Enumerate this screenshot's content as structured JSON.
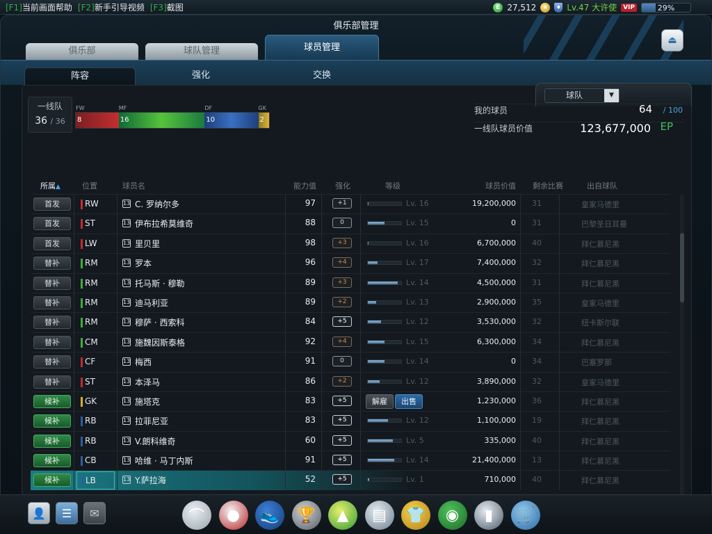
{
  "hotkeys": [
    {
      "key": "[F1]",
      "label": "当前画面帮助"
    },
    {
      "key": "[F2]",
      "label": "新手引导视频"
    },
    {
      "key": "[F3]",
      "label": "截图"
    }
  ],
  "status": {
    "coin_icon": "E",
    "money": "27,512",
    "level": "Lv.47 大许使",
    "vip": "VIP",
    "progress_label": "29%",
    "progress": 0.29
  },
  "window_title": "俱乐部管理",
  "main_tabs": [
    "俱乐部",
    "球队管理",
    "球员管理"
  ],
  "sub_tabs": [
    "阵容",
    "强化",
    "交换"
  ],
  "filter": {
    "value": "球队",
    "arrow": "▼"
  },
  "lineup": {
    "label": "一线队",
    "count": "36",
    "total": "/ 36"
  },
  "positions": [
    {
      "label": "FW",
      "count": "8",
      "color": "#c32c2c"
    },
    {
      "label": "MF",
      "count": "16",
      "color": "#3fae3a"
    },
    {
      "label": "DF",
      "count": "10",
      "color": "#2e5da5"
    },
    {
      "label": "GK",
      "count": "2",
      "color": "#d8b12c"
    }
  ],
  "summary": {
    "my_players_label": "我的球员",
    "my_players": "64",
    "my_players_max": "/ 100",
    "value_label": "一线队球员价值",
    "value": "123,677,000",
    "currency": "EP"
  },
  "columns": {
    "role": "所属",
    "sort_icon": "▲",
    "pos": "位置",
    "name": "球员名",
    "ability": "能力值",
    "enhance": "强化",
    "grade": "等级",
    "value": "球员价值",
    "remaining": "剩余比赛",
    "club": "出自球队"
  },
  "actions": {
    "fire": "解雇",
    "sell": "出售"
  },
  "players": [
    {
      "role": "首发",
      "role_type": "start",
      "pos": "RW",
      "pos_color": "#c32c2c",
      "age": "13",
      "name": "C. 罗纳尔多",
      "ability": "97",
      "enhance": "+1",
      "enh_style": "w",
      "level_fill": 0.02,
      "level": "Lv. 16",
      "value": "19,200,000",
      "remaining": "31",
      "club": "皇家马德里"
    },
    {
      "role": "首发",
      "role_type": "start",
      "pos": "ST",
      "pos_color": "#c32c2c",
      "age": "13",
      "name": "伊布拉希莫维奇",
      "ability": "88",
      "enhance": "0",
      "enh_style": "w",
      "level_fill": 0.5,
      "level": "Lv. 15",
      "value": "0",
      "remaining": "31",
      "club": "巴黎圣日耳曼"
    },
    {
      "role": "首发",
      "role_type": "start",
      "pos": "LW",
      "pos_color": "#c32c2c",
      "age": "13",
      "name": "里贝里",
      "ability": "98",
      "enhance": "+3",
      "enh_style": "o",
      "level_fill": 0.02,
      "level": "Lv. 16",
      "value": "6,700,000",
      "remaining": "40",
      "club": "拜仁慕尼黑"
    },
    {
      "role": "替补",
      "role_type": "sub",
      "pos": "RM",
      "pos_color": "#3fae3a",
      "age": "13",
      "name": "罗本",
      "ability": "96",
      "enhance": "+4",
      "enh_style": "o",
      "level_fill": 0.3,
      "level": "Lv. 17",
      "value": "7,400,000",
      "remaining": "32",
      "club": "拜仁慕尼黑"
    },
    {
      "role": "替补",
      "role_type": "sub",
      "pos": "RM",
      "pos_color": "#3fae3a",
      "age": "13",
      "name": "托马斯 · 穆勒",
      "ability": "89",
      "enhance": "+3",
      "enh_style": "o",
      "level_fill": 0.9,
      "level": "Lv. 14",
      "value": "4,500,000",
      "remaining": "31",
      "club": "拜仁慕尼黑"
    },
    {
      "role": "替补",
      "role_type": "sub",
      "pos": "RM",
      "pos_color": "#3fae3a",
      "age": "13",
      "name": "迪马利亚",
      "ability": "89",
      "enhance": "+2",
      "enh_style": "o",
      "level_fill": 0.25,
      "level": "Lv. 13",
      "value": "2,900,000",
      "remaining": "35",
      "club": "皇家马德里"
    },
    {
      "role": "替补",
      "role_type": "sub",
      "pos": "RM",
      "pos_color": "#3fae3a",
      "age": "13",
      "name": "穆萨 · 西索科",
      "ability": "84",
      "enhance": "+5",
      "enh_style": "b",
      "level_fill": 0.4,
      "level": "Lv. 12",
      "value": "3,530,000",
      "remaining": "32",
      "club": "纽卡斯尔联"
    },
    {
      "role": "替补",
      "role_type": "sub",
      "pos": "CM",
      "pos_color": "#3fae3a",
      "age": "13",
      "name": "施魏因斯泰格",
      "ability": "92",
      "enhance": "+4",
      "enh_style": "o",
      "level_fill": 0.5,
      "level": "Lv. 15",
      "value": "6,300,000",
      "remaining": "34",
      "club": "拜仁慕尼黑"
    },
    {
      "role": "替补",
      "role_type": "sub",
      "pos": "CF",
      "pos_color": "#c32c2c",
      "age": "13",
      "name": "梅西",
      "ability": "91",
      "enhance": "0",
      "enh_style": "w",
      "level_fill": 0.5,
      "level": "Lv. 14",
      "value": "0",
      "remaining": "34",
      "club": "巴塞罗那"
    },
    {
      "role": "替补",
      "role_type": "sub",
      "pos": "ST",
      "pos_color": "#c32c2c",
      "age": "13",
      "name": "本泽马",
      "ability": "86",
      "enhance": "+2",
      "enh_style": "o",
      "level_fill": 0.35,
      "level": "Lv. 12",
      "value": "3,890,000",
      "remaining": "32",
      "club": "皇家马德里"
    },
    {
      "role": "候补",
      "role_type": "res",
      "pos": "GK",
      "pos_color": "#d8b12c",
      "age": "13",
      "name": "施塔克",
      "ability": "83",
      "enhance": "+5",
      "enh_style": "b",
      "level_fill": 0,
      "level": "",
      "value": "1,230,000",
      "remaining": "36",
      "club": "拜仁慕尼黑",
      "buttons": true
    },
    {
      "role": "候补",
      "role_type": "res",
      "pos": "RB",
      "pos_color": "#2e5da5",
      "age": "13",
      "name": "拉菲尼亚",
      "ability": "83",
      "enhance": "+5",
      "enh_style": "b",
      "level_fill": 0.6,
      "level": "Lv. 12",
      "value": "1,100,000",
      "remaining": "19",
      "club": "拜仁慕尼黑"
    },
    {
      "role": "候补",
      "role_type": "res",
      "pos": "RB",
      "pos_color": "#2e5da5",
      "age": "13",
      "name": "V.朗科维奇",
      "ability": "60",
      "enhance": "+5",
      "enh_style": "b",
      "level_fill": 0.75,
      "level": "Lv. 5",
      "value": "335,000",
      "remaining": "40",
      "club": "拜仁慕尼黑"
    },
    {
      "role": "候补",
      "role_type": "res",
      "pos": "CB",
      "pos_color": "#2e5da5",
      "age": "13",
      "name": "哈维 · 马丁内斯",
      "ability": "91",
      "enhance": "+5",
      "enh_style": "b",
      "level_fill": 0.8,
      "level": "Lv. 14",
      "value": "21,400,000",
      "remaining": "13",
      "club": "拜仁慕尼黑"
    },
    {
      "role": "候补",
      "role_type": "res",
      "pos": "LB",
      "pos_color": "#2e5da5",
      "age": "13",
      "name": "Y.萨拉海",
      "ability": "52",
      "enhance": "+5",
      "enh_style": "b",
      "level_fill": 0.05,
      "level": "Lv. 1",
      "value": "710,000",
      "remaining": "40",
      "club": "拜仁慕尼黑",
      "selected": true
    }
  ],
  "bottom_icons": [
    "whistle-icon",
    "ball-icon",
    "boots-icon",
    "trophy-icon",
    "pyramid-icon",
    "clipboard-icon",
    "jersey-icon",
    "club-icon",
    "card-icon",
    "cart-icon"
  ]
}
